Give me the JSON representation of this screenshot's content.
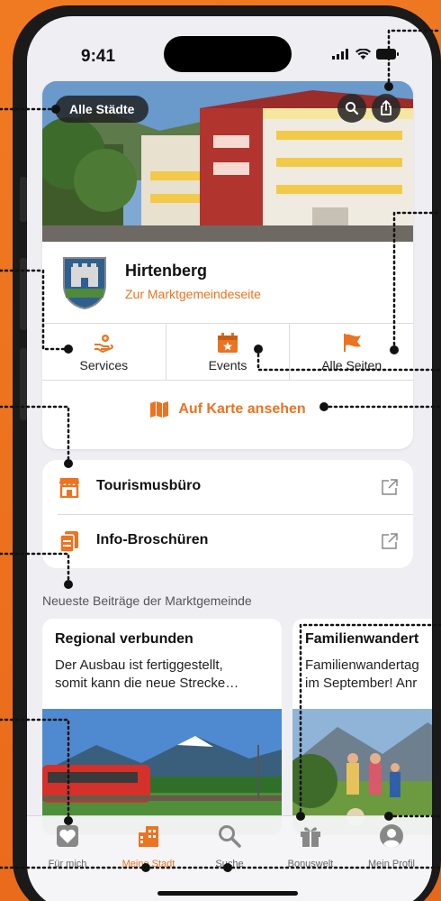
{
  "status": {
    "time": "9:41"
  },
  "hero": {
    "chip_label": "Alle Städte"
  },
  "town": {
    "name": "Hirtenberg",
    "link": "Zur Marktgemeindeseite"
  },
  "actions": [
    {
      "label": "Services",
      "icon": "services-hand-gear-icon"
    },
    {
      "label": "Events",
      "icon": "calendar-star-icon"
    },
    {
      "label": "Alle Seiten",
      "icon": "flag-icon"
    }
  ],
  "map": {
    "label": "Auf Karte ansehen",
    "icon": "map-icon"
  },
  "links": [
    {
      "label": "Tourismusbüro",
      "icon": "shop-icon"
    },
    {
      "label": "Info-Broschüren",
      "icon": "documents-icon"
    }
  ],
  "section_title": "Neueste Beiträge der Marktgemeinde",
  "posts": [
    {
      "title": "Regional verbunden",
      "text_line1": "Der Ausbau ist fertiggestellt,",
      "text_line2": "somit kann die neue Strecke…"
    },
    {
      "title": "Familienwandert",
      "text_line1": "Familienwandertag",
      "text_line2": "im September! Anr"
    }
  ],
  "tabs": [
    {
      "label": "Für mich",
      "icon": "heart-box-icon"
    },
    {
      "label": "Meine Stadt",
      "icon": "city-icon",
      "active": true
    },
    {
      "label": "Suche",
      "icon": "search-icon"
    },
    {
      "label": "Bonuswelt",
      "icon": "gift-icon"
    },
    {
      "label": "Mein Profil",
      "icon": "profile-icon"
    }
  ],
  "colors": {
    "accent": "#ea7421",
    "background": "#e8681a"
  }
}
